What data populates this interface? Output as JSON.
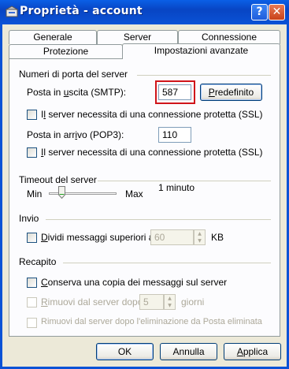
{
  "window": {
    "title": "Proprietà - account",
    "help_label": "?",
    "close_label": "✕"
  },
  "tabs": {
    "row_top": [
      "Generale",
      "Server",
      "Connessione"
    ],
    "row_bottom": [
      "Protezione",
      "Impostazioni avanzate"
    ],
    "active": "Impostazioni avanzate"
  },
  "ports": {
    "group_label": "Numeri di porta del server",
    "smtp_label_pre": "Posta in ",
    "smtp_label_u": "u",
    "smtp_label_post": "scita (SMTP):",
    "smtp_value": "587",
    "default_button": "Predefinito",
    "default_button_u": "P",
    "smtp_ssl_pre": "I",
    "smtp_ssl_u": "l",
    "smtp_ssl_post": " server necessita di una connessione protetta (SSL)",
    "pop3_label_pre": "Posta in arr",
    "pop3_label_u": "i",
    "pop3_label_post": "vo (POP3):",
    "pop3_value": "110",
    "pop3_ssl_pre": "",
    "pop3_ssl_u": "I",
    "pop3_ssl_post": "l server necessita di una connessione protetta (SSL)"
  },
  "timeout": {
    "group_label": "Timeout del server",
    "min_label": "Min",
    "max_label": "Max",
    "value_label": "1 minuto"
  },
  "send": {
    "group_label": "Invio",
    "split_pre": "",
    "split_u": "D",
    "split_post": "ividi messaggi superiori a",
    "split_value": "60",
    "unit": "KB"
  },
  "delivery": {
    "group_label": "Recapito",
    "keep_pre": "",
    "keep_u": "C",
    "keep_post": "onserva una copia dei messaggi sul server",
    "remove_after_pre": "",
    "remove_after_u": "R",
    "remove_after_post": "imuovi dal server dopo",
    "remove_after_value": "5",
    "days_label": "giorni",
    "remove_deleted_label": "Rimuovi dal server dopo l'eliminazione da Posta eliminata"
  },
  "footer": {
    "ok": "OK",
    "cancel": "Annulla",
    "apply_pre": "",
    "apply_u": "A",
    "apply_post": "pplica"
  },
  "colors": {
    "titlebar": "#0A52D6",
    "highlight": "#D0151A",
    "face": "#ECE9D8"
  }
}
